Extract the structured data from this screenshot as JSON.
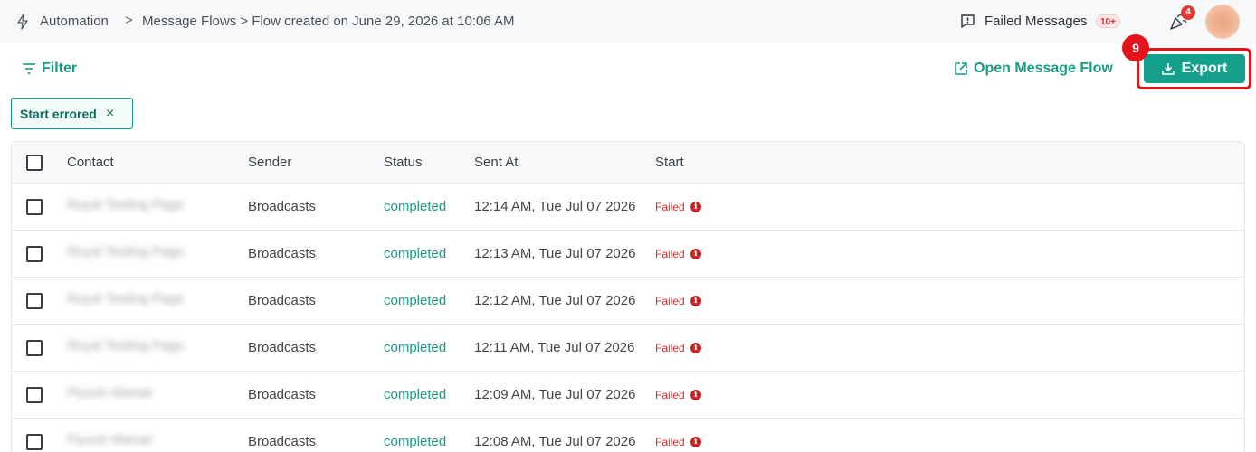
{
  "header": {
    "breadcrumb": {
      "section_icon": "lightning-icon",
      "section": "Automation",
      "separator": ">",
      "current": "Message Flows > Flow created on June 29, 2026 at 10:06 AM"
    },
    "failed_messages": {
      "icon": "message-alert-icon",
      "label": "Failed Messages",
      "count": "10+"
    },
    "notifications": {
      "icon": "party-popper-icon",
      "count": "4"
    },
    "avatar": {
      "icon": "user-avatar"
    }
  },
  "toolbar": {
    "filter_label": "Filter",
    "open_flow_label": "Open Message Flow",
    "export_label": "Export",
    "step_number": "9"
  },
  "active_filters": [
    {
      "label": "Start errored",
      "remove": "×"
    }
  ],
  "table": {
    "columns": [
      "Contact",
      "Sender",
      "Status",
      "Sent At",
      "Start"
    ],
    "rows": [
      {
        "contact": "Royal Testing Page",
        "sender": "Broadcasts",
        "status": "completed",
        "sent_at": "12:14 AM, Tue Jul 07 2026",
        "start": "Failed"
      },
      {
        "contact": "Royal Testing Page",
        "sender": "Broadcasts",
        "status": "completed",
        "sent_at": "12:13 AM, Tue Jul 07 2026",
        "start": "Failed"
      },
      {
        "contact": "Royal Testing Page",
        "sender": "Broadcasts",
        "status": "completed",
        "sent_at": "12:12 AM, Tue Jul 07 2026",
        "start": "Failed"
      },
      {
        "contact": "Royal Testing Page",
        "sender": "Broadcasts",
        "status": "completed",
        "sent_at": "12:11 AM, Tue Jul 07 2026",
        "start": "Failed"
      },
      {
        "contact": "Piyush Manair",
        "sender": "Broadcasts",
        "status": "completed",
        "sent_at": "12:09 AM, Tue Jul 07 2026",
        "start": "Failed"
      },
      {
        "contact": "Piyush Manair",
        "sender": "Broadcasts",
        "status": "completed",
        "sent_at": "12:08 AM, Tue Jul 07 2026",
        "start": "Failed"
      }
    ]
  },
  "colors": {
    "accent": "#14a08a",
    "accent_text": "#1a9a82",
    "error": "#d32f2f",
    "highlight": "#e3141b"
  }
}
